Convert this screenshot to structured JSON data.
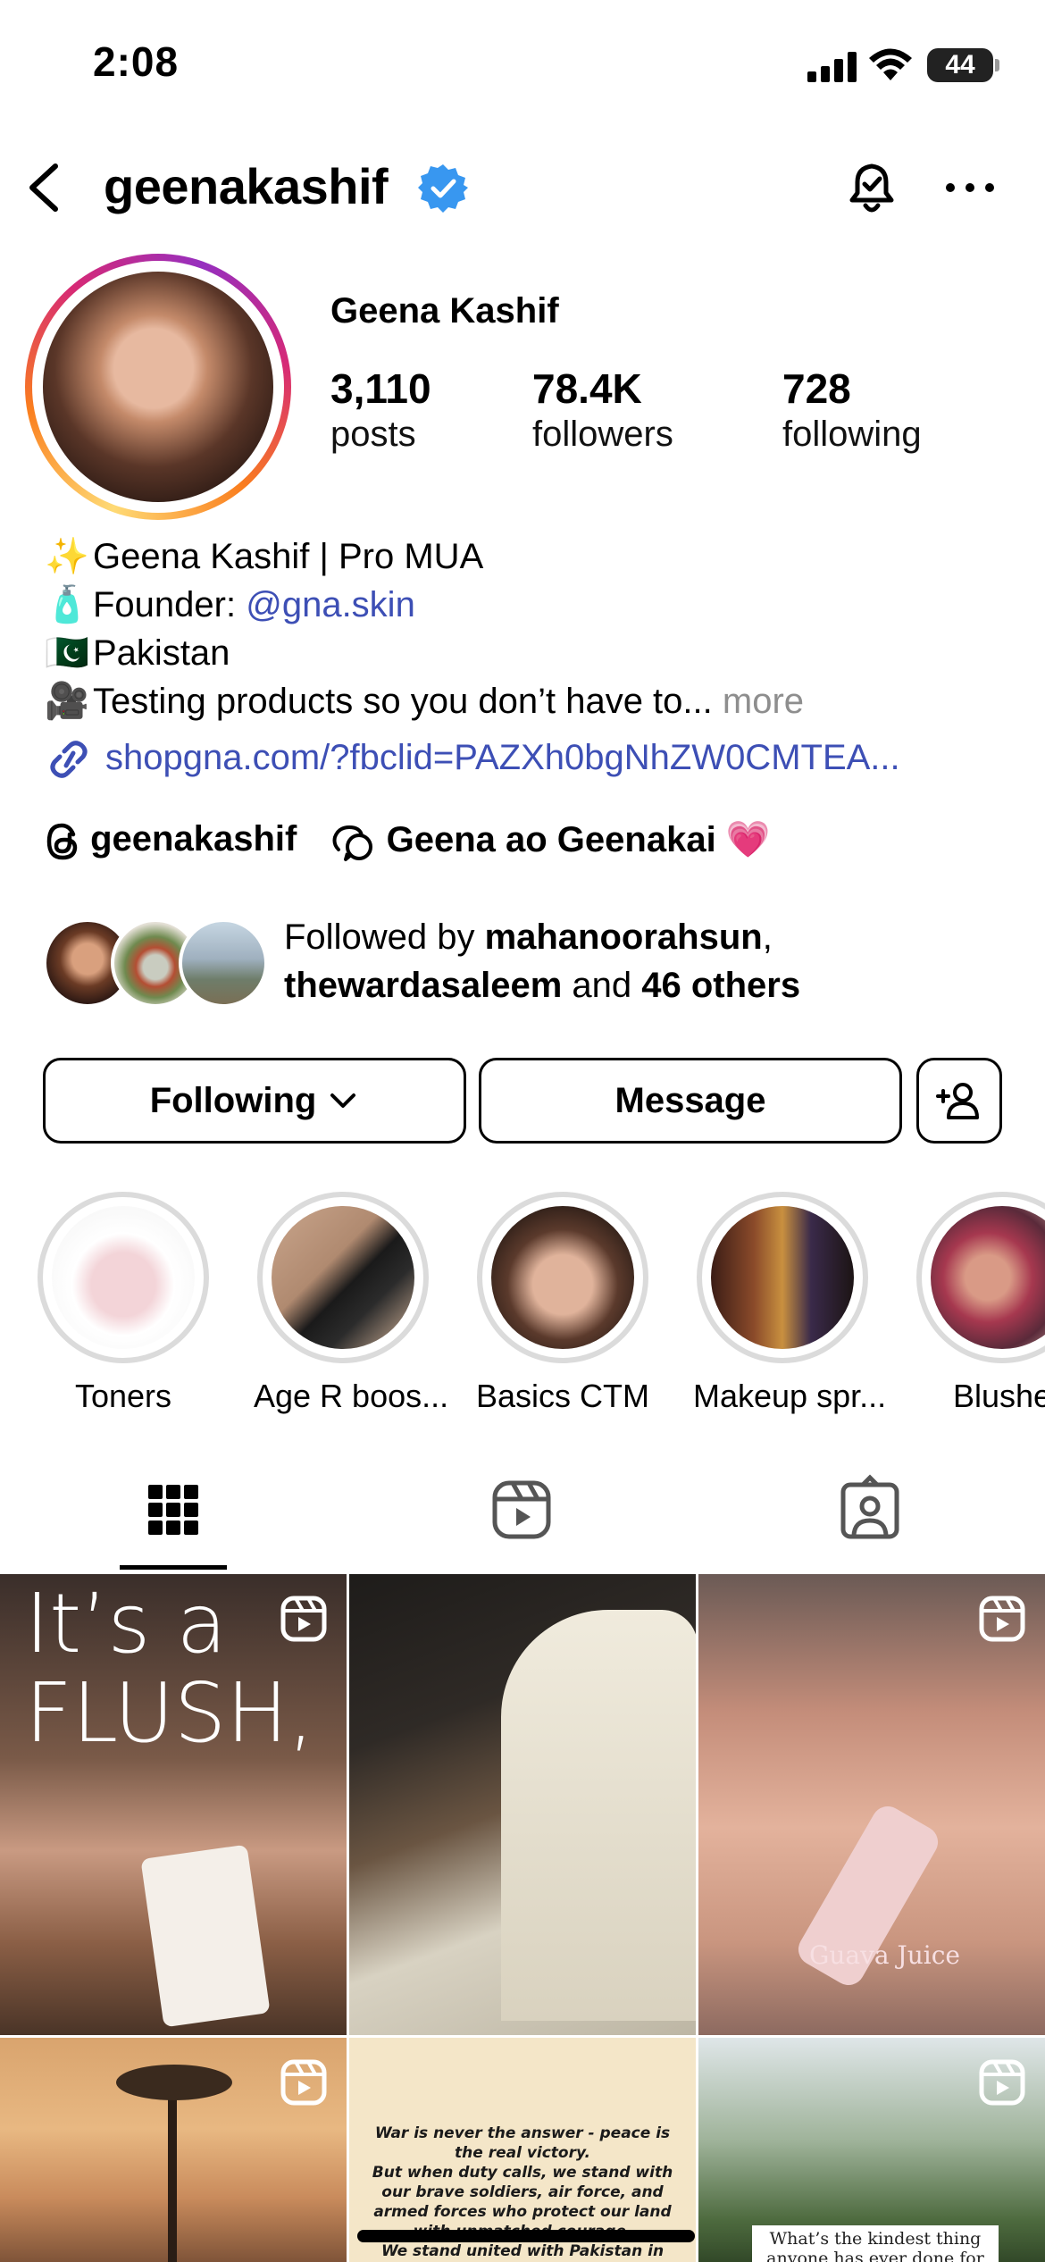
{
  "status_bar": {
    "time": "2:08",
    "battery": "44"
  },
  "header": {
    "username": "geenakashif"
  },
  "profile": {
    "display_name": "Geena Kashif",
    "stats": [
      {
        "value": "3,110",
        "label": "posts"
      },
      {
        "value": "78.4K",
        "label": "followers"
      },
      {
        "value": "728",
        "label": "following"
      }
    ]
  },
  "bio": {
    "line1_emoji": "✨",
    "line1": "Geena Kashif | Pro MUA",
    "line2_emoji": "🧴",
    "line2_prefix": "Founder: ",
    "line2_mention": "@gna.skin",
    "line3_emoji": "🇵🇰",
    "line3": "Pakistan",
    "line4_emoji": "🎥",
    "line4": "Testing products so you don’t have to...",
    "line4_more": "more",
    "link": "shopgna.com/?fbclid=PAZXh0bgNhZW0CMTEA..."
  },
  "social": {
    "threads_handle": "geenakashif",
    "channel_name": "Geena ao Geenakai",
    "channel_emoji": "💗"
  },
  "followed_by": {
    "prefix": "Followed by ",
    "user1": "mahanoorahsun",
    "sep": ",",
    "user2": "thewardasaleem",
    "and": " and ",
    "others": "46 others"
  },
  "buttons": {
    "following": "Following",
    "message": "Message"
  },
  "highlights": [
    {
      "label": "Toners"
    },
    {
      "label": "Age R boos..."
    },
    {
      "label": "Basics CTM"
    },
    {
      "label": "Makeup spr..."
    },
    {
      "label": "Blushe"
    }
  ],
  "posts": {
    "post1_text_a": "It’s a",
    "post1_text_b": "FLUSH,",
    "post3_caption": "Guava Juice",
    "post5_lines": [
      "War is never the answer - peace is",
      "the real victory.",
      "But when duty calls, we stand with",
      "our brave soldiers, air force, and",
      "armed forces who protect our land",
      "with unmatched courage.",
      "We stand united with Pakistan in"
    ],
    "post6_lines": [
      "What’s the kindest thing",
      "anyone has ever done for you"
    ]
  },
  "colors": {
    "link": "#3d4fb5",
    "verified": "#3897f0",
    "muted": "#8e8e8e"
  }
}
